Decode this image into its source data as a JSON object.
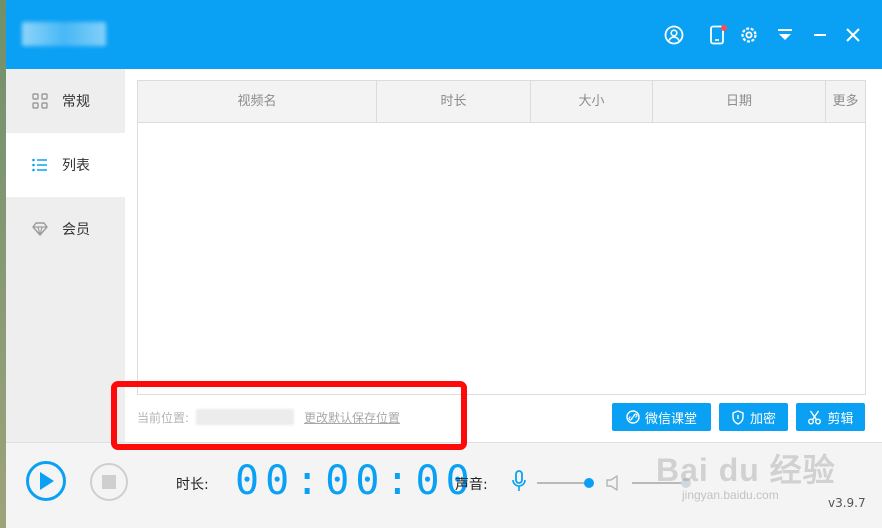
{
  "titlebar": {
    "bg_color": "#0aa0f3"
  },
  "sidebar": {
    "items": [
      {
        "label": "常规",
        "icon": "grid-icon",
        "active": false
      },
      {
        "label": "列表",
        "icon": "list-icon",
        "active": true
      },
      {
        "label": "会员",
        "icon": "diamond-icon",
        "active": false
      }
    ]
  },
  "table": {
    "columns": [
      "视频名",
      "时长",
      "大小",
      "日期",
      "更多"
    ],
    "rows": []
  },
  "location": {
    "label": "当前位置:",
    "change_link": "更改默认保存位置"
  },
  "buttons": {
    "wechat": "微信课堂",
    "encrypt": "加密",
    "cut": "剪辑"
  },
  "controls": {
    "duration_label": "时长:",
    "timer": "00:00:00",
    "sound_label": "声音:",
    "mic_level": 0.9,
    "speaker_level": 0.9
  },
  "version": "v3.9.7",
  "watermark": {
    "main": "Bai du 经验",
    "sub": "jingyan.baidu.com"
  },
  "colors": {
    "accent": "#0aa0f3",
    "highlight": "#ff0a0a"
  }
}
